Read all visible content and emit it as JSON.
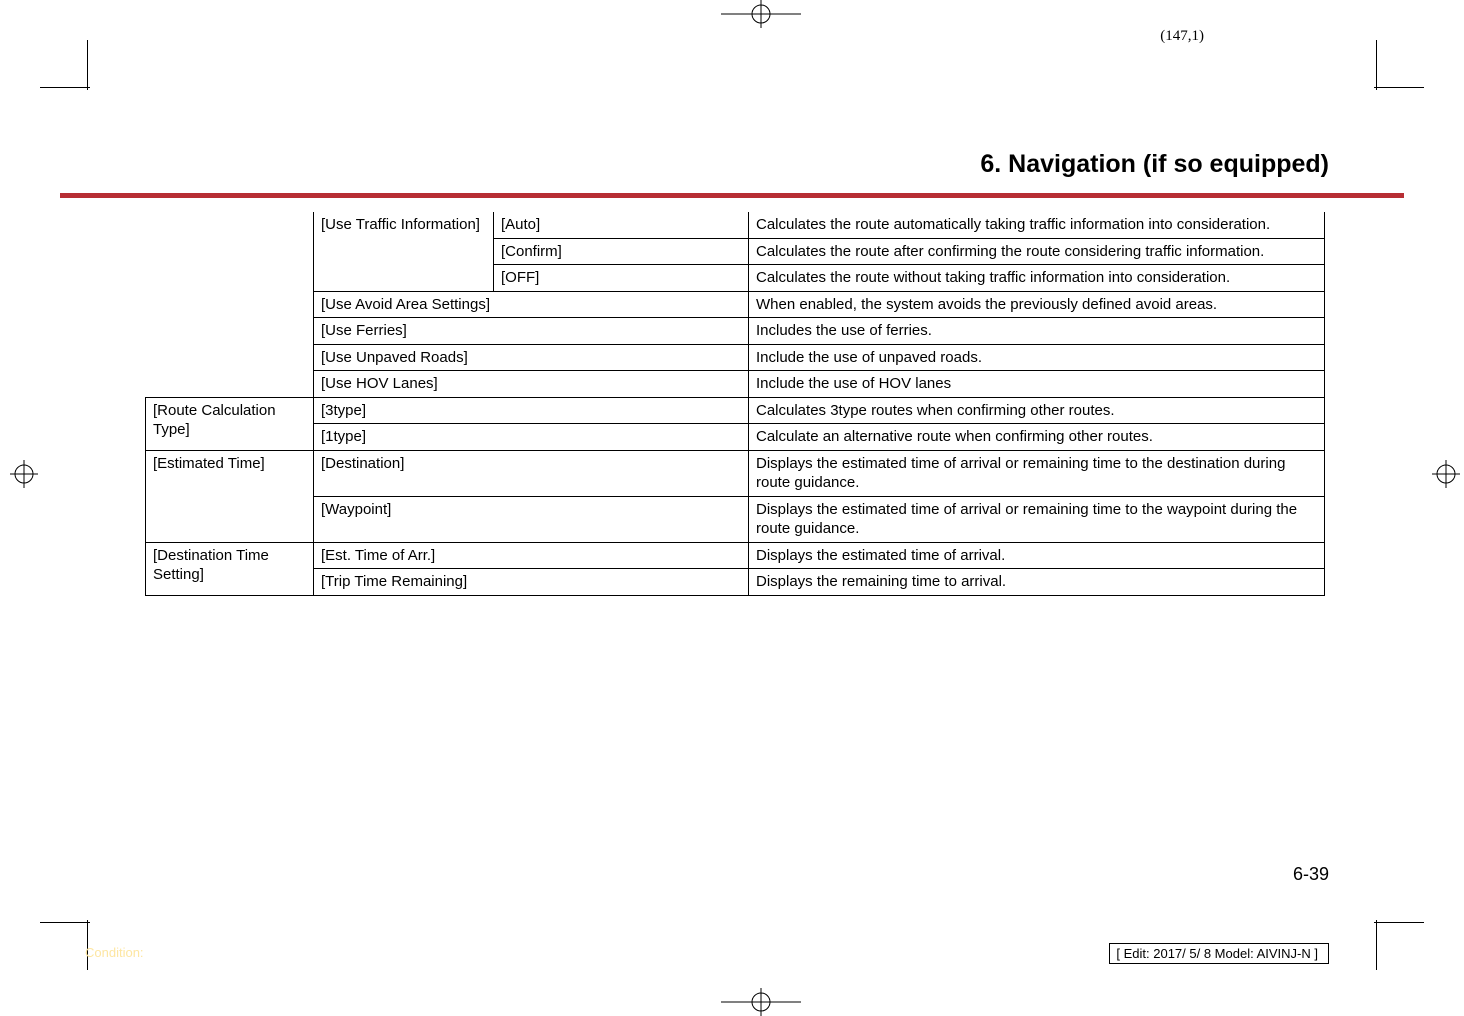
{
  "page_coord": "(147,1)",
  "chapter_title": "6. Navigation (if so equipped)",
  "table": {
    "r0": {
      "c1": "[Use Traffic Information]",
      "c2": "[Auto]",
      "c3": "Calculates the route automatically taking traffic information into consideration."
    },
    "r1": {
      "c2": "[Confirm]",
      "c3": "Calculates the route after confirming the route considering traffic information."
    },
    "r2": {
      "c2": "[OFF]",
      "c3": "Calculates the route without taking traffic information into consideration."
    },
    "r3": {
      "c1": "[Use Avoid Area Settings]",
      "c3": "When enabled, the system avoids the previously defined avoid areas."
    },
    "r4": {
      "c1": "[Use Ferries]",
      "c3": "Includes the use of ferries."
    },
    "r5": {
      "c1": "[Use Unpaved Roads]",
      "c3": "Include the use of unpaved roads."
    },
    "r6": {
      "c1": "[Use HOV Lanes]",
      "c3": "Include the use of HOV lanes"
    },
    "r7": {
      "c0": "[Route Calculation Type]",
      "c1": "[3type]",
      "c3": "Calculates 3type routes when confirming other routes."
    },
    "r8": {
      "c1": "[1type]",
      "c3": "Calculate an alternative route when confirming other routes."
    },
    "r9": {
      "c0": "[Estimated Time]",
      "c1": "[Destination]",
      "c3": "Displays the estimated time of arrival or remaining time to the destination during route guidance."
    },
    "r10": {
      "c1": "[Waypoint]",
      "c3": "Displays the estimated time of arrival or remaining time to the waypoint during the route guidance."
    },
    "r11": {
      "c0": "[Destination Time Setting]",
      "c1": "[Est. Time of Arr.]",
      "c3": "Displays the estimated time of arrival."
    },
    "r12": {
      "c1": "[Trip Time Remaining]",
      "c3": "Displays the remaining time to arrival."
    }
  },
  "pagenum": "6-39",
  "condition": "Condition:",
  "edit_box": "[ Edit: 2017/ 5/ 8   Model:  AIVINJ-N ]"
}
